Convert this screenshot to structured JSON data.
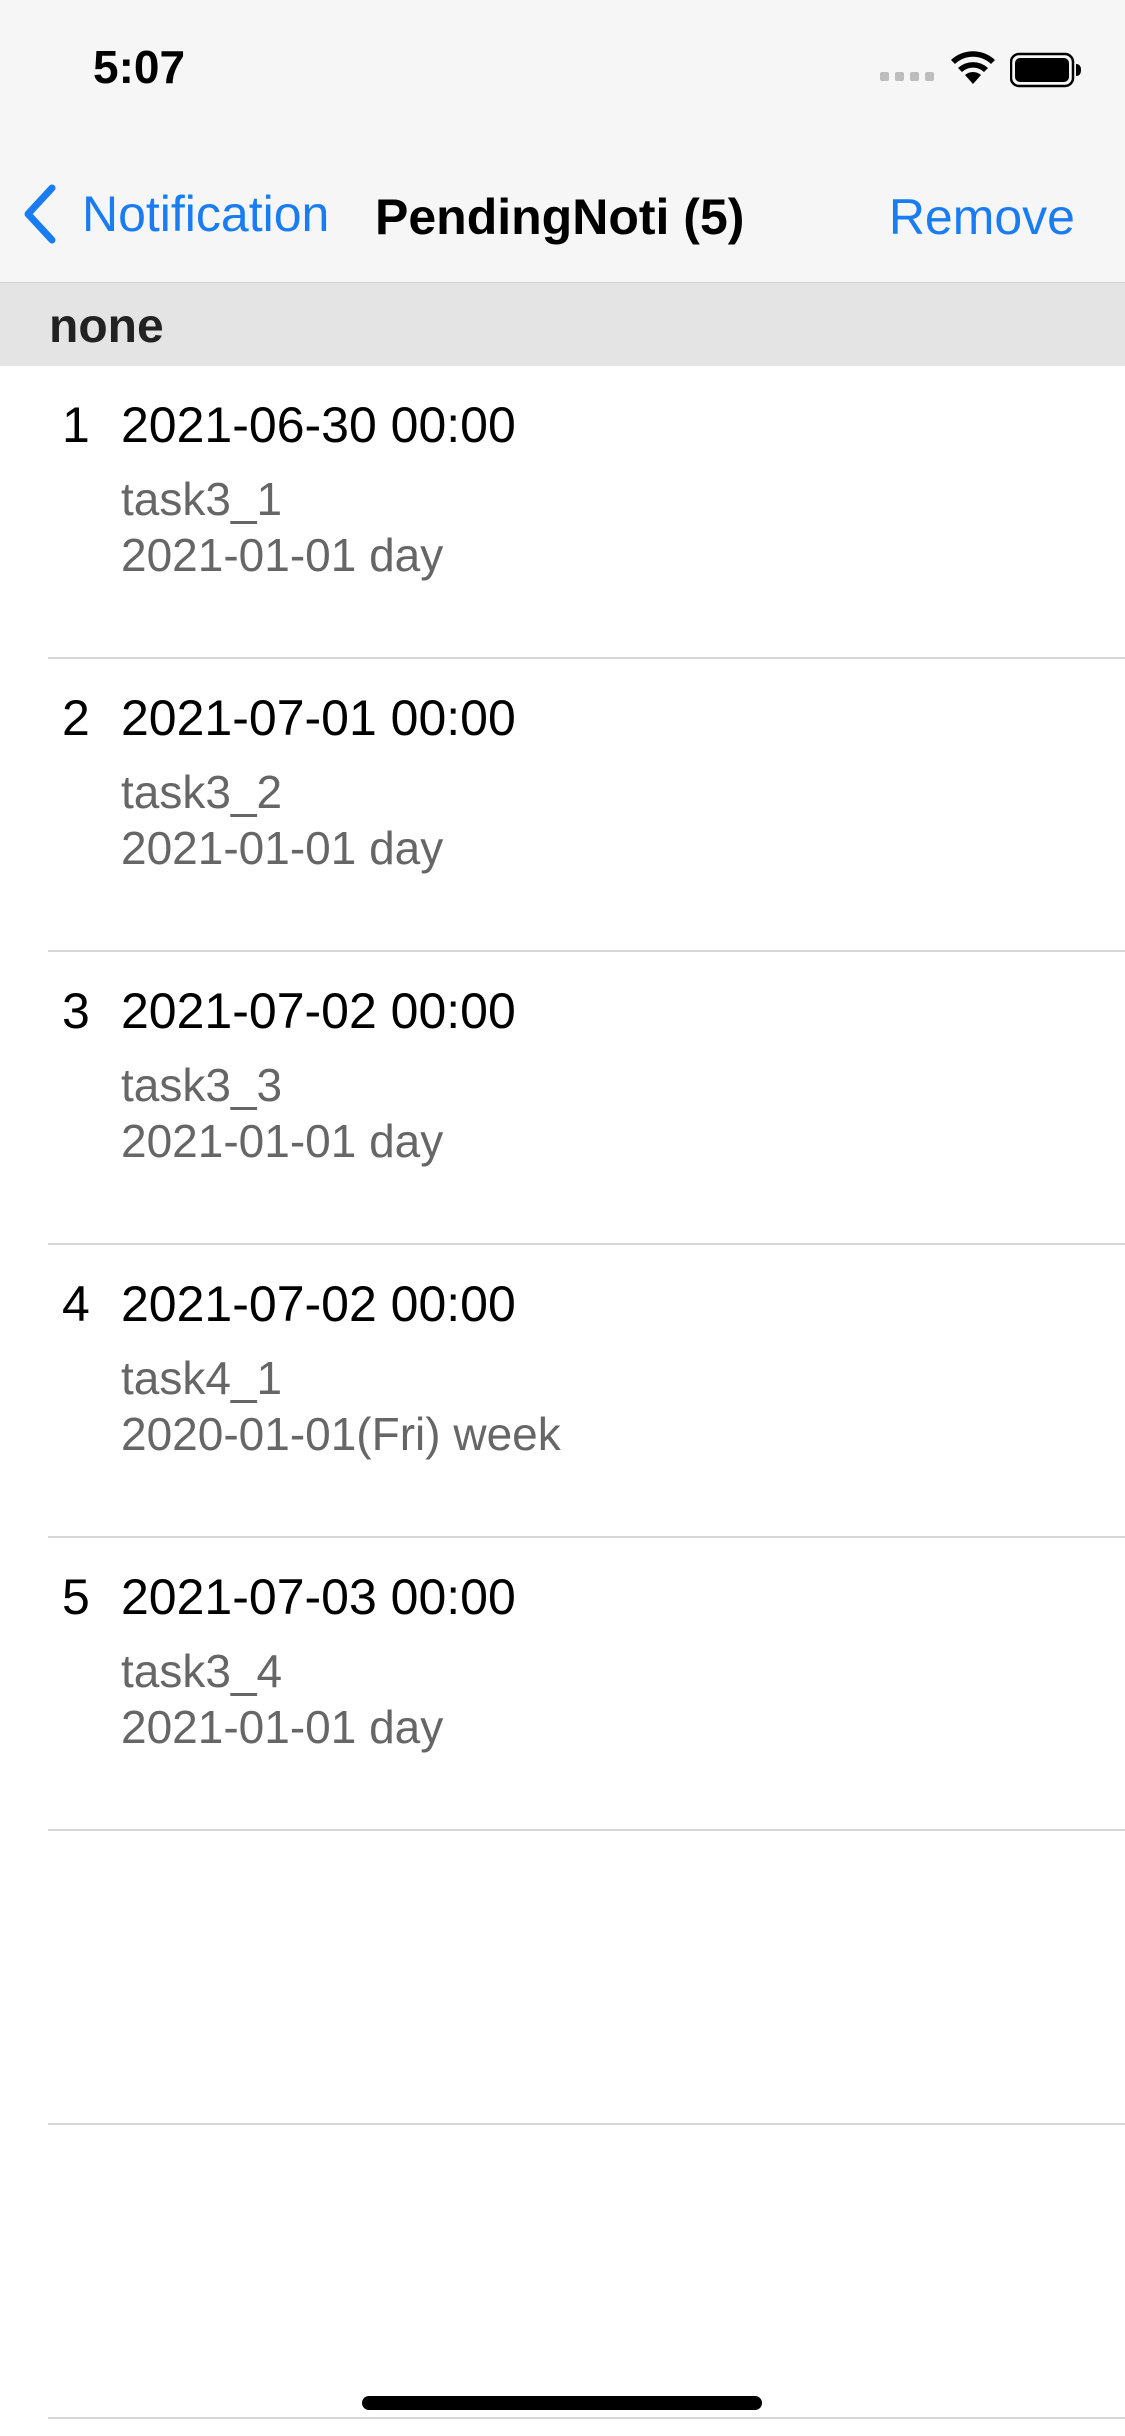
{
  "status_bar": {
    "time": "5:07"
  },
  "nav": {
    "back_label": "Notification",
    "title": "PendingNoti (5)",
    "remove_label": "Remove"
  },
  "section": {
    "header": "none"
  },
  "items": [
    {
      "index": "1",
      "title": "2021-06-30 00:00",
      "subtitle": "task3_1",
      "detail": "2021-01-01 day"
    },
    {
      "index": "2",
      "title": "2021-07-01 00:00",
      "subtitle": "task3_2",
      "detail": "2021-01-01 day"
    },
    {
      "index": "3",
      "title": "2021-07-02 00:00",
      "subtitle": "task3_3",
      "detail": "2021-01-01 day"
    },
    {
      "index": "4",
      "title": "2021-07-02 00:00",
      "subtitle": "task4_1",
      "detail": "2020-01-01(Fri) week"
    },
    {
      "index": "5",
      "title": "2021-07-03 00:00",
      "subtitle": "task3_4",
      "detail": "2021-01-01 day"
    }
  ],
  "colors": {
    "accent": "#1a7cf2",
    "secondary_text": "#666666",
    "section_bg": "#e4e4e4"
  },
  "icons": {
    "back": "chevron-left-icon",
    "signal": "cellular-signal-icon",
    "wifi": "wifi-icon",
    "battery": "battery-icon"
  }
}
